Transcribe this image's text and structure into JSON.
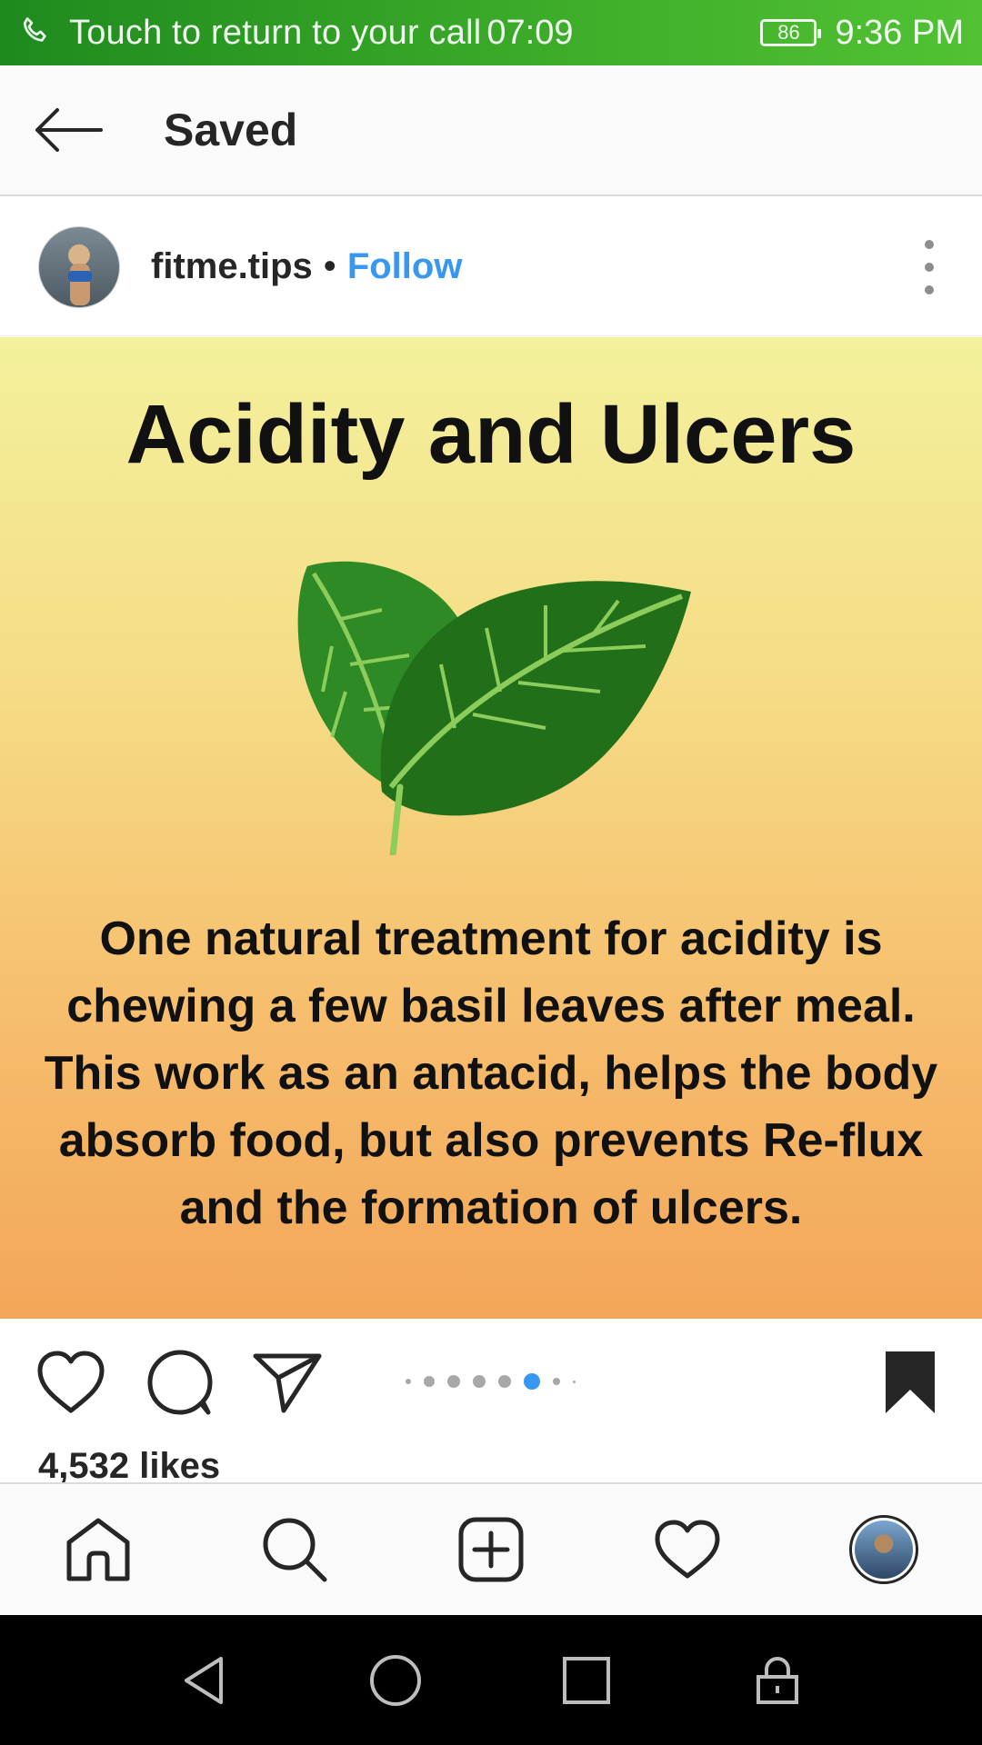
{
  "status_bar": {
    "call_text": "Touch to return to your call",
    "call_timer": "07:09",
    "battery": "86",
    "time": "9:36 PM"
  },
  "header": {
    "title": "Saved"
  },
  "post": {
    "username": "fitme.tips",
    "separator": "•",
    "follow_label": "Follow",
    "image": {
      "title": "Acidity  and Ulcers",
      "body": "One natural treatment for acidity is chewing a few basil leaves after meal. This work as an antacid, helps the body absorb food, but also prevents Re-flux and the formation of ulcers."
    },
    "carousel": {
      "total_dots": 7,
      "active_index": 5
    },
    "likes": "4,532 likes"
  },
  "colors": {
    "status_bar": "#3fae2a",
    "follow": "#3897f0",
    "active_dot": "#3897f0"
  },
  "icons": {
    "status": [
      "phone-icon",
      "battery-icon"
    ],
    "header": [
      "back-arrow-icon"
    ],
    "actions": [
      "heart-icon",
      "comment-icon",
      "share-icon",
      "bookmark-icon"
    ],
    "nav": [
      "home-icon",
      "search-icon",
      "add-icon",
      "activity-heart-icon",
      "profile-avatar"
    ],
    "system": [
      "back-triangle-icon",
      "home-circle-icon",
      "recents-square-icon",
      "lock-icon"
    ]
  }
}
